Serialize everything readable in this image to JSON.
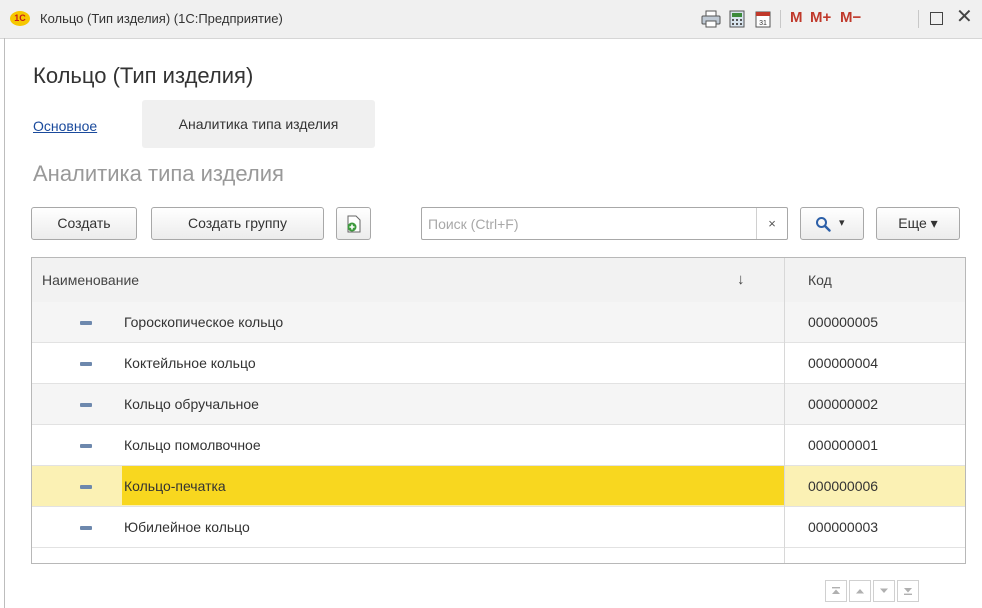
{
  "window": {
    "title": "Кольцо (Тип изделия)  (1С:Предприятие)",
    "logo_text": "1С",
    "memory_buttons": [
      "M",
      "M+",
      "M−"
    ],
    "close": "✕"
  },
  "form": {
    "title": "Кольцо (Тип изделия)",
    "tabs": [
      {
        "label": "Основное",
        "active": false
      },
      {
        "label": "Аналитика типа изделия",
        "active": true
      }
    ],
    "section_title": "Аналитика типа изделия"
  },
  "toolbar": {
    "create": "Создать",
    "create_group": "Создать группу",
    "search_placeholder": "Поиск (Ctrl+F)",
    "clear": "×",
    "search_button": "▾",
    "more": "Еще ▾"
  },
  "table": {
    "columns": [
      "Наименование",
      "Код"
    ],
    "sort_indicator": "↓",
    "rows": [
      {
        "name": "Гороскопическое кольцо",
        "code": "000000005"
      },
      {
        "name": "Коктейльное кольцо",
        "code": "000000004"
      },
      {
        "name": "Кольцо обручальное",
        "code": "000000002"
      },
      {
        "name": "Кольцо помолвочное",
        "code": "000000001"
      },
      {
        "name": "Кольцо-печатка",
        "code": "000000006",
        "selected": true
      },
      {
        "name": "Юбилейное кольцо",
        "code": "000000003"
      }
    ]
  },
  "colors": {
    "selection": "#f8d71f",
    "selection_row": "#fbf1b4",
    "link": "#1a4a9c",
    "memory_buttons": "#c0392b"
  }
}
